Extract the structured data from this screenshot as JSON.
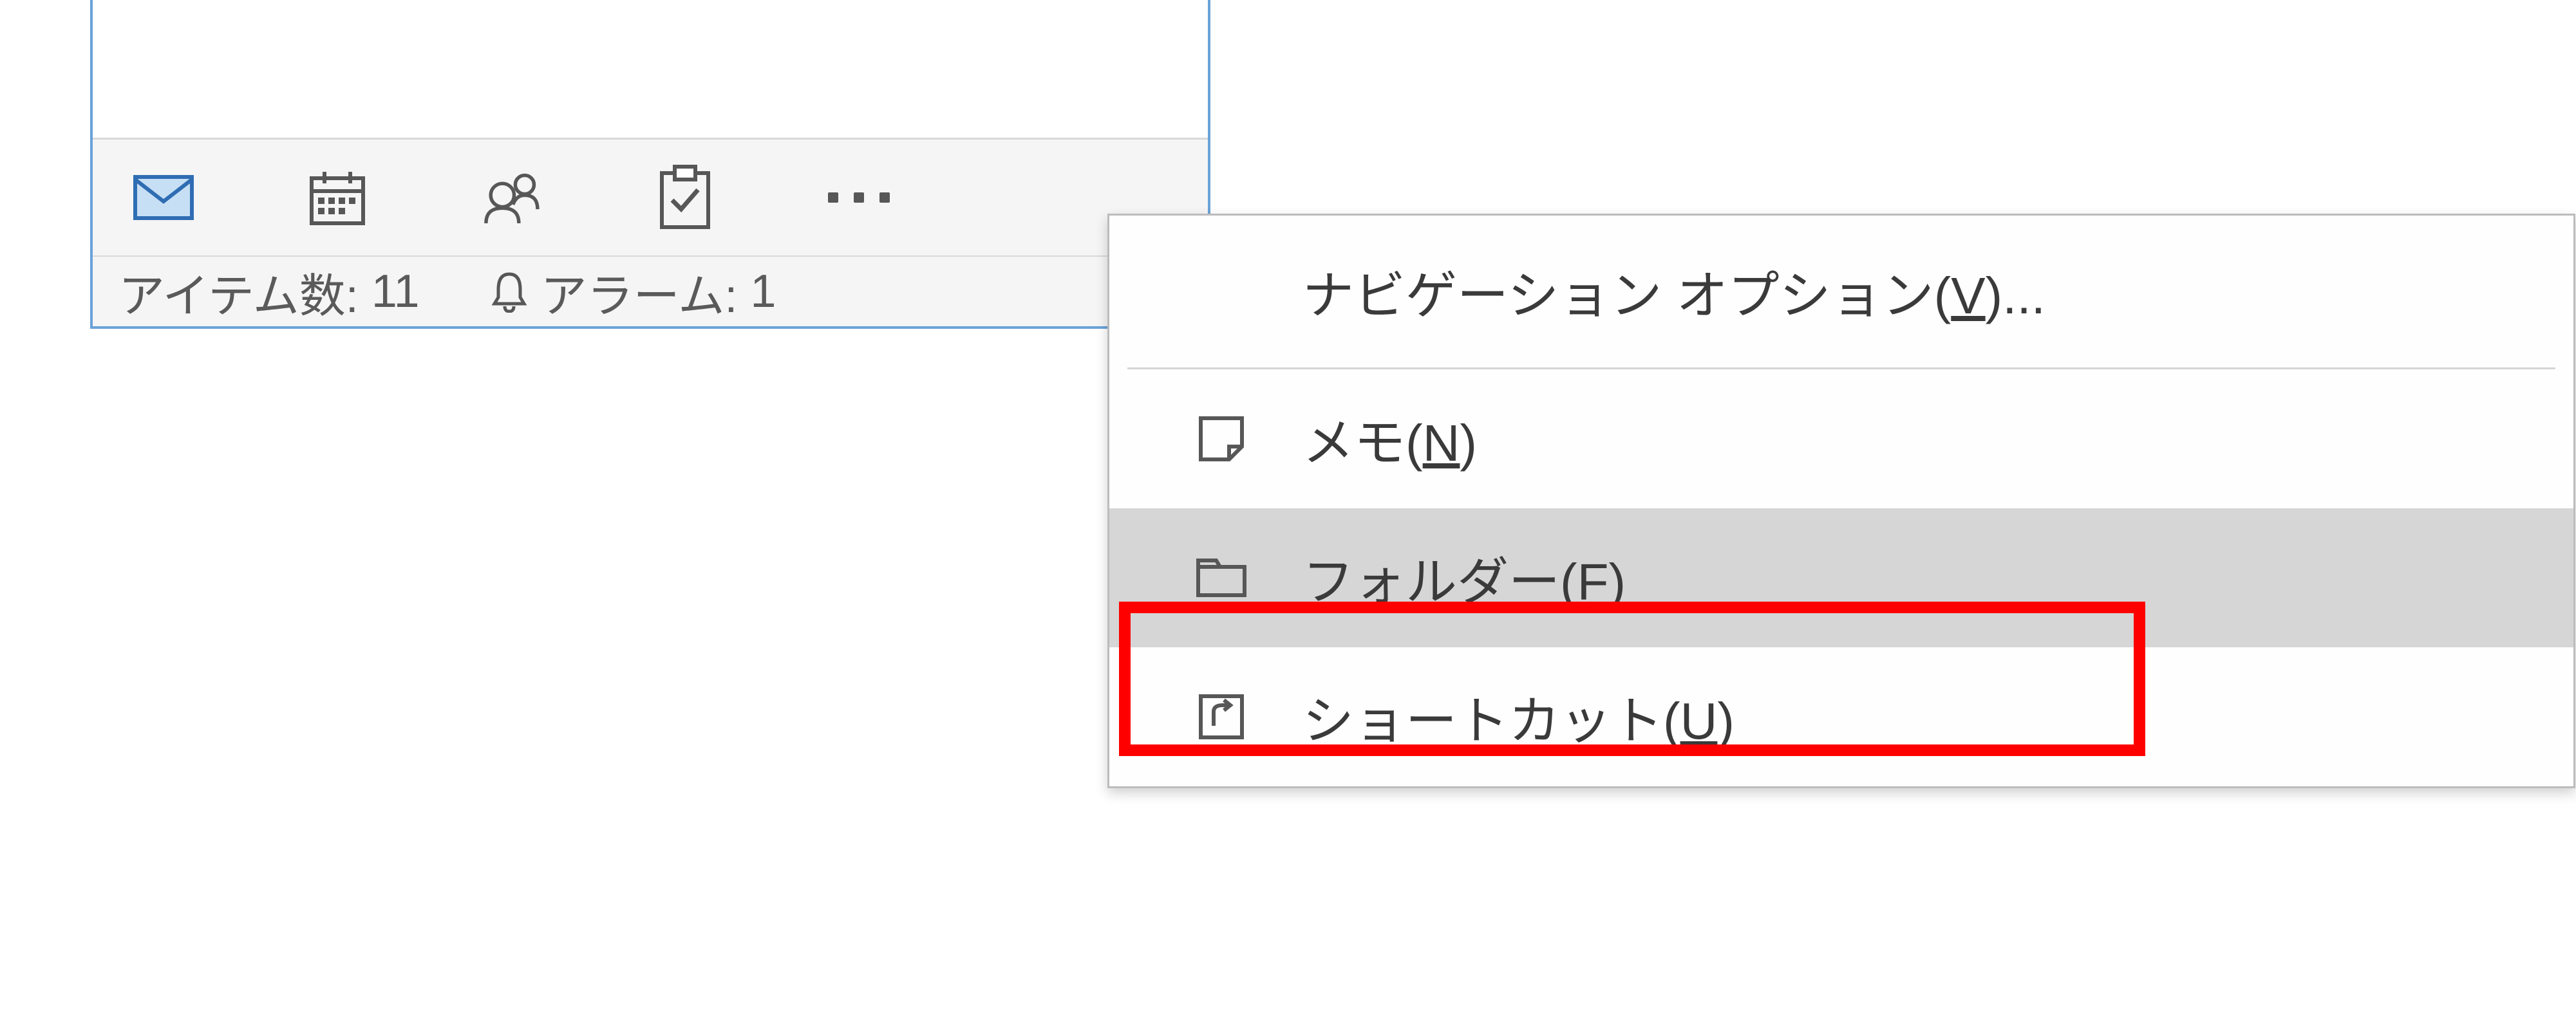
{
  "nav": {
    "mail": "mail",
    "calendar": "calendar",
    "people": "people",
    "tasks": "tasks",
    "more": "more"
  },
  "status": {
    "items_label": "アイテム数:",
    "items_value": "11",
    "alarm_label": "アラーム:",
    "alarm_value": "1"
  },
  "popup": {
    "nav_options_prefix": "ナビゲーション オプション(",
    "nav_options_key": "V",
    "nav_options_suffix": ")...",
    "items": [
      {
        "icon": "note",
        "label_prefix": "メモ(",
        "key": "N",
        "label_suffix": ")",
        "hover": false
      },
      {
        "icon": "folder",
        "label_prefix": "フォルダー(",
        "key": "F",
        "label_suffix": ")",
        "hover": true
      },
      {
        "icon": "shortcut",
        "label_prefix": "ショートカット(",
        "key": "U",
        "label_suffix": ")",
        "hover": false
      }
    ]
  }
}
